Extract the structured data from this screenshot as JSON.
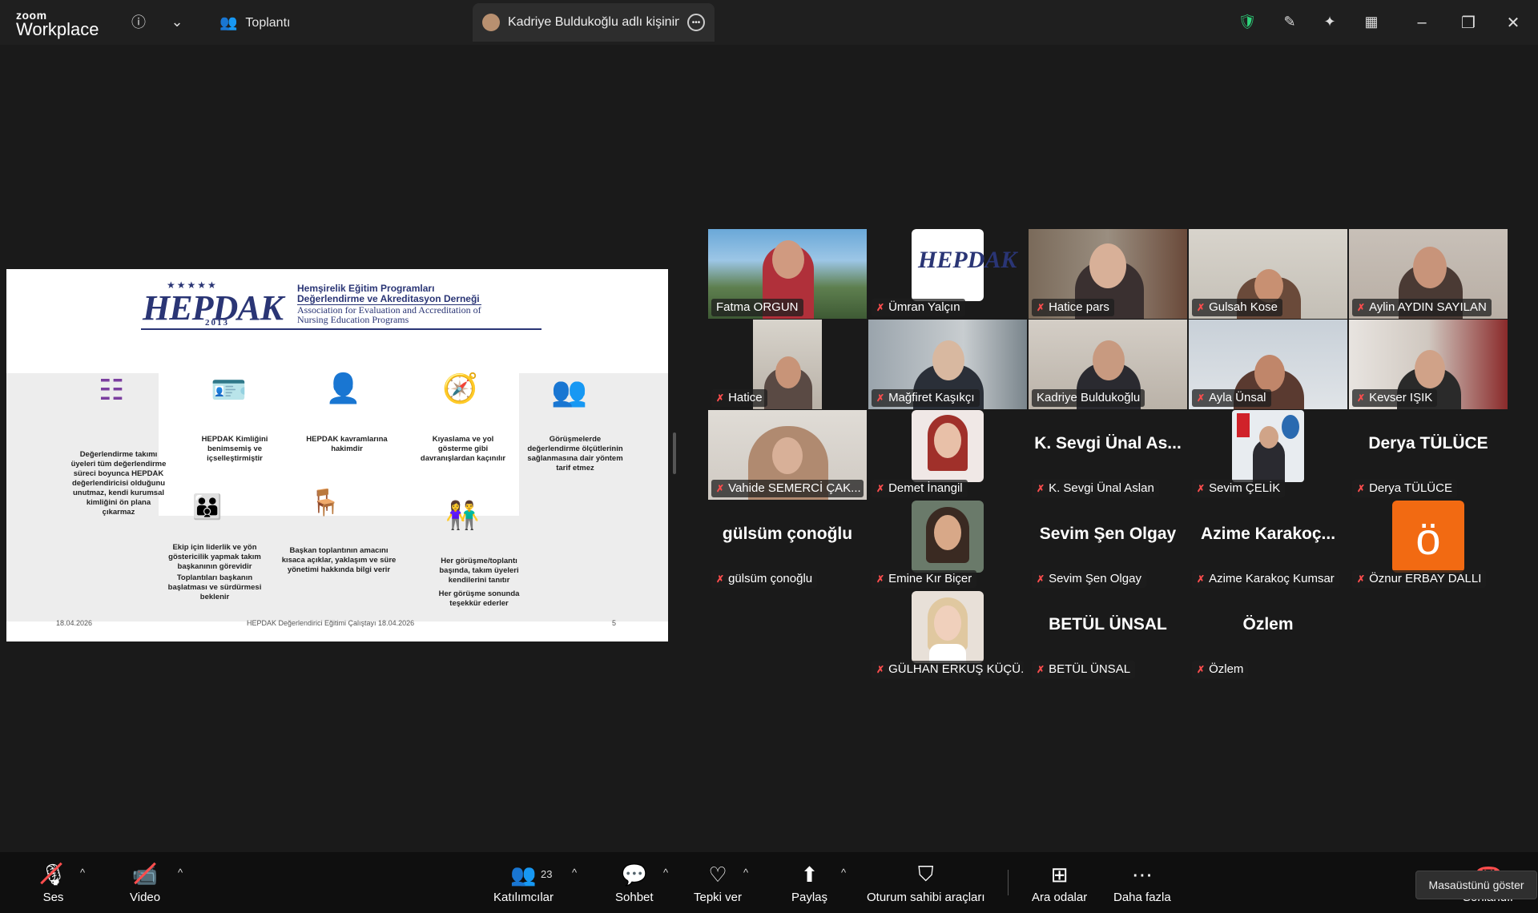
{
  "app": {
    "logo_small": "zoom",
    "logo_big": "Workplace",
    "meeting_label": "Toplantı",
    "speaker_tab": "Kadriye Buldukoğlu adlı kişinin ek",
    "colors": {
      "active_speaker": "#2fd47c",
      "muted": "#ff4d4d",
      "background": "#1a1a1a"
    }
  },
  "slide": {
    "header": {
      "logo_word": "HEPDAK",
      "logo_year": "2013",
      "tr_line1": "Hemşirelik Eğitim Programları",
      "tr_line2": "Değerlendirme ve Akreditasyon Derneği",
      "en_line1": "Association for Evaluation and Accreditation of",
      "en_line2": "Nursing Education Programs"
    },
    "items": [
      "Değerlendirme takımı üyeleri tüm değerlendirme süreci boyunca HEPDAK değerlendiricisi olduğunu unutmaz, kendi kurumsal kimliğini ön plana çıkarmaz",
      "HEPDAK Kimliğini benimsemiş ve içselleştirmiştir",
      "HEPDAK kavramlarına hakimdir",
      "Kıyaslama ve yol gösterme gibi davranışlardan kaçınılır",
      "Görüşmelerde değerlendirme ölçütlerinin sağlanmasına dair yöntem tarif etmez",
      "Ekip için liderlik ve yön göstericilik yapmak takım başkanının görevidir",
      "Toplantıları başkanın başlatması ve sürdürmesi beklenir",
      "Başkan toplantının amacını kısaca açıklar, yaklaşım ve süre yönetimi hakkında bilgi verir",
      "Her görüşme/toplantı başında, takım üyeleri kendilerini tanıtır",
      "Her görüşme sonunda teşekkür ederler"
    ],
    "footer": {
      "date": "18.04.2026",
      "title": "HEPDAK Değerlendirici Eğitimi Çalıştayı 18.04.2026",
      "page": "5"
    }
  },
  "participants": [
    {
      "name": "Fatma ORGUN",
      "muted": false,
      "kind": "video"
    },
    {
      "name": "Ümran Yalçın",
      "muted": true,
      "kind": "logo"
    },
    {
      "name": "Hatice pars",
      "muted": true,
      "kind": "video"
    },
    {
      "name": "Gulsah Kose",
      "muted": true,
      "kind": "video"
    },
    {
      "name": "Aylin AYDIN SAYILAN",
      "muted": true,
      "kind": "video"
    },
    {
      "name": "Hatice",
      "muted": true,
      "kind": "video"
    },
    {
      "name": "Mağfiret Kaşıkçı",
      "muted": true,
      "kind": "video"
    },
    {
      "name": "Kadriye Buldukoğlu",
      "muted": false,
      "kind": "video",
      "active": true
    },
    {
      "name": "Ayla Ünsal",
      "muted": true,
      "kind": "video"
    },
    {
      "name": "Kevser IŞIK",
      "muted": true,
      "kind": "video"
    },
    {
      "name": "Vahide SEMERCİ ÇAK...",
      "muted": true,
      "kind": "video"
    },
    {
      "name": "Demet İnangil",
      "muted": true,
      "kind": "photo"
    },
    {
      "name": "K. Sevgi Ünal Aslan",
      "muted": true,
      "kind": "text",
      "big": "K. Sevgi Ünal As..."
    },
    {
      "name": "Sevim ÇELİK",
      "muted": true,
      "kind": "photo"
    },
    {
      "name": "Derya TÜLÜCE",
      "muted": true,
      "kind": "text",
      "big": "Derya TÜLÜCE"
    },
    {
      "name": "gülsüm çonoğlu",
      "muted": true,
      "kind": "text",
      "big": "gülsüm çonoğlu"
    },
    {
      "name": "Emine Kır Biçer",
      "muted": true,
      "kind": "photo"
    },
    {
      "name": "Sevim Şen Olgay",
      "muted": true,
      "kind": "text",
      "big": "Sevim Şen Olgay"
    },
    {
      "name": "Azime Karakoç Kumsar",
      "muted": true,
      "kind": "text",
      "big": "Azime  Karakoç..."
    },
    {
      "name": "Öznur ERBAY DALLI",
      "muted": true,
      "kind": "letter",
      "big": "ö"
    },
    {
      "name": "GÜLHAN ERKUŞ KÜÇÜ...",
      "muted": true,
      "kind": "photo"
    },
    {
      "name": "BETÜL ÜNSAL",
      "muted": true,
      "kind": "text",
      "big": "BETÜL ÜNSAL"
    },
    {
      "name": "Özlem",
      "muted": true,
      "kind": "text",
      "big": "Özlem"
    }
  ],
  "toolbar": {
    "audio": "Ses",
    "video": "Video",
    "participants": "Katılımcılar",
    "participants_count": "23",
    "chat": "Sohbet",
    "react": "Tepki ver",
    "share": "Paylaş",
    "host_tools": "Oturum sahibi araçları",
    "breakout": "Ara odalar",
    "more": "Daha fazla",
    "end": "Sonlandır",
    "tooltip": "Masaüstünü göster"
  }
}
